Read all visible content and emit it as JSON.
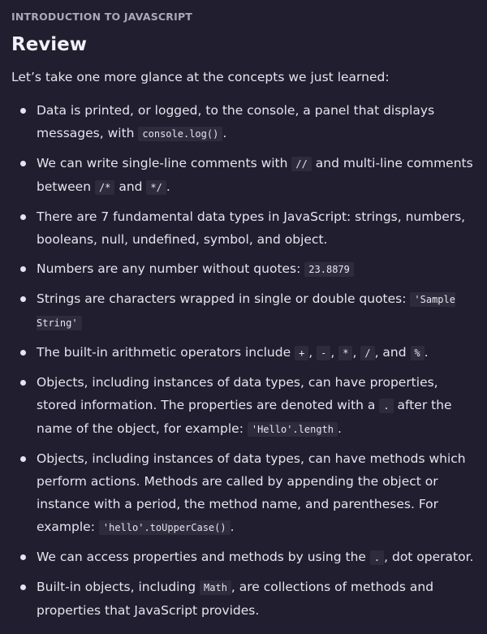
{
  "header": {
    "eyebrow": "INTRODUCTION TO JAVASCRIPT",
    "title": "Review",
    "intro": "Let’s take one more glance at the concepts we just learned:"
  },
  "points": [
    {
      "t1": "Data is printed, or logged, to the console, a panel that displays messages, with ",
      "c1": "console.log()",
      "t2": "."
    },
    {
      "t1": "We can write single-line comments with ",
      "c1": "//",
      "t2": " and multi-line comments between ",
      "c2": "/*",
      "t3": " and ",
      "c3": "*/",
      "t4": "."
    },
    {
      "t1": "There are 7 fundamental data types in JavaScript: strings, numbers, booleans, null, undefined, symbol, and object."
    },
    {
      "t1": "Numbers are any number without quotes: ",
      "c1": "23.8879"
    },
    {
      "t1": "Strings are characters wrapped in single or double quotes: ",
      "c1": "'Sample String'"
    },
    {
      "t1": "The built-in arithmetic operators include ",
      "c1": "+",
      "t2": ", ",
      "c2": "-",
      "t3": ", ",
      "c3": "*",
      "t4": ", ",
      "c4": "/",
      "t5": ", and ",
      "c5": "%",
      "t6": "."
    },
    {
      "t1": "Objects, including instances of data types, can have properties, stored information. The properties are denoted with a ",
      "c1": ".",
      "t2": " after the name of the object, for example: ",
      "c2": "'Hello'.length",
      "t3": "."
    },
    {
      "t1": "Objects, including instances of data types, can have methods which perform actions. Methods are called by appending the object or instance with a period, the method name, and parentheses. For example: ",
      "c1": "'hello'.toUpperCase()",
      "t2": "."
    },
    {
      "t1": "We can access properties and methods by using the ",
      "c1": ".",
      "t2": ", dot operator."
    },
    {
      "t1": "Built-in objects, including ",
      "c1": "Math",
      "t2": ", are collections of methods and properties that JavaScript provides."
    }
  ]
}
